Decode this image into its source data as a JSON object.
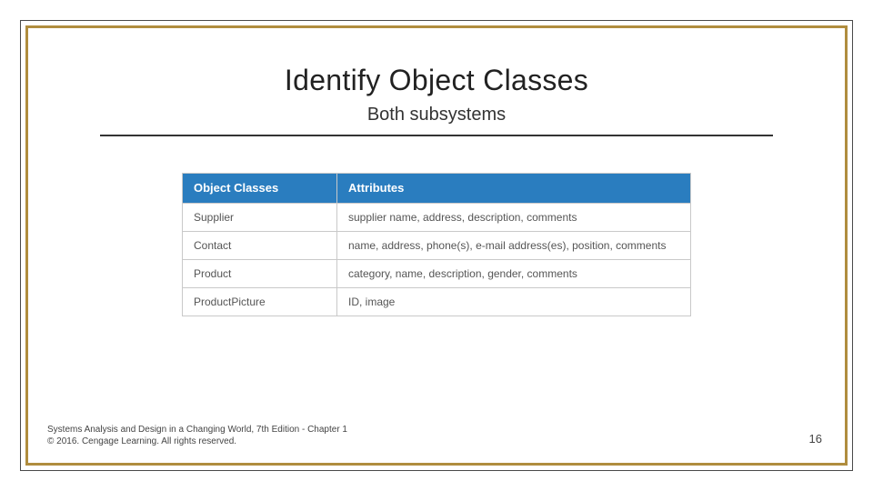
{
  "title": "Identify Object Classes",
  "subtitle": "Both subsystems",
  "table": {
    "header": {
      "col1": "Object Classes",
      "col2": "Attributes"
    },
    "rows": [
      {
        "col1": "Supplier",
        "col2": "supplier name, address, description, comments"
      },
      {
        "col1": "Contact",
        "col2": "name, address, phone(s), e-mail address(es), position, comments"
      },
      {
        "col1": "Product",
        "col2": "category, name, description, gender, comments"
      },
      {
        "col1": "ProductPicture",
        "col2": "ID, image"
      }
    ]
  },
  "footer": {
    "line1": "Systems Analysis and Design in a Changing World, 7th Edition - Chapter 1",
    "line2": "© 2016. Cengage Learning. All rights reserved."
  },
  "page_number": "16"
}
